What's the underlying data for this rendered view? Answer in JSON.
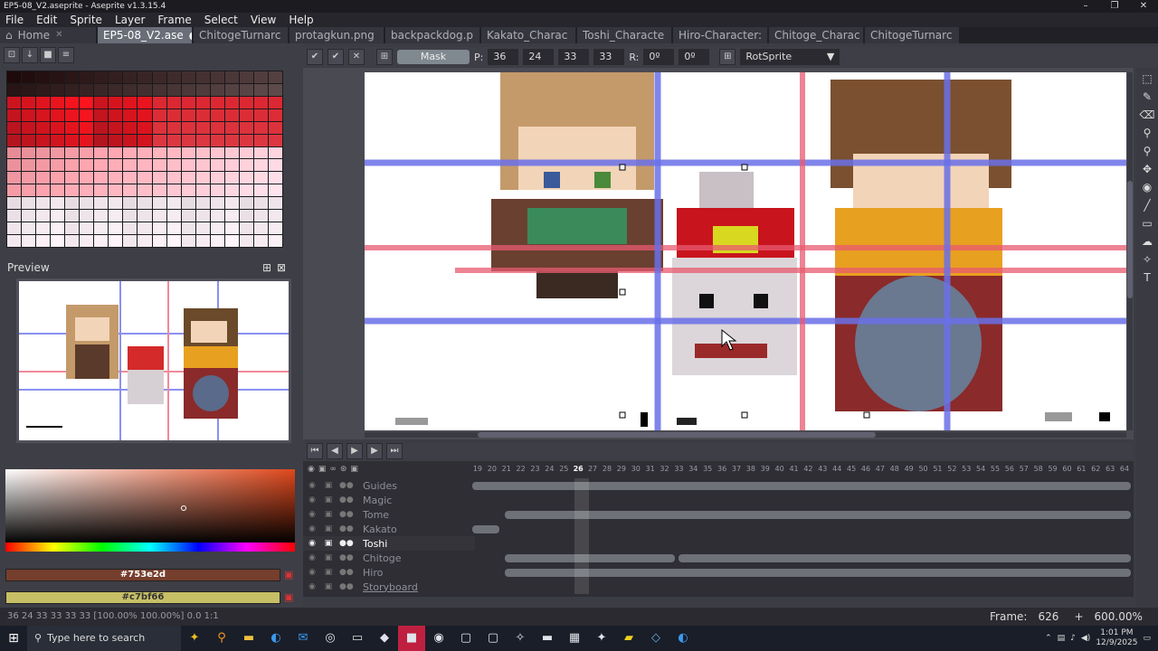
{
  "window": {
    "title": "EP5-08_V2.aseprite - Aseprite v1.3.15.4",
    "min": "–",
    "max": "❐",
    "close": "✕"
  },
  "menu": [
    "File",
    "Edit",
    "Sprite",
    "Layer",
    "Frame",
    "Select",
    "View",
    "Help"
  ],
  "tabs": [
    {
      "label": "Home",
      "active": false
    },
    {
      "label": "EP5-08_V2.ase",
      "active": true
    },
    {
      "label": "ChitogeTurnarc",
      "active": false
    },
    {
      "label": "protagkun.png",
      "active": false
    },
    {
      "label": "backpackdog.p",
      "active": false
    },
    {
      "label": "Kakato_Charac",
      "active": false
    },
    {
      "label": "Toshi_Characte",
      "active": false
    },
    {
      "label": "Hiro-Character:",
      "active": false
    },
    {
      "label": "Chitoge_Charac",
      "active": false
    },
    {
      "label": "ChitogeTurnarc",
      "active": false
    }
  ],
  "toolbar_options": {
    "mask_label": "Mask",
    "p_label": "P:",
    "p_x": "36",
    "p_y": "24",
    "p_w": "33",
    "p_h": "33",
    "r_label": "R:",
    "r1": "0º",
    "r2": "0º",
    "algorithm": "RotSprite"
  },
  "preview": {
    "title": "Preview"
  },
  "colors": {
    "foreground_hex": "#753e2d",
    "background_hex": "#c7bf66",
    "accent": "#e0481c"
  },
  "timeline": {
    "frame_numbers": [
      "19",
      "20",
      "21",
      "22",
      "23",
      "24",
      "25",
      "26",
      "27",
      "28",
      "29",
      "30",
      "31",
      "32",
      "33",
      "34",
      "35",
      "36",
      "37",
      "38",
      "39",
      "40",
      "41",
      "42",
      "43",
      "44",
      "45",
      "46",
      "47",
      "48",
      "49",
      "50",
      "51",
      "52",
      "53",
      "54",
      "55",
      "56",
      "57",
      "58",
      "59",
      "60",
      "61",
      "62",
      "63",
      "64"
    ],
    "current_frame": "26",
    "layers": [
      {
        "name": "Guides",
        "active": false
      },
      {
        "name": "Magic",
        "active": false
      },
      {
        "name": "Tome",
        "active": false
      },
      {
        "name": "Kakato",
        "active": false
      },
      {
        "name": "Toshi",
        "active": true
      },
      {
        "name": "Chitoge",
        "active": false
      },
      {
        "name": "Hiro",
        "active": false
      },
      {
        "name": "Storyboard",
        "active": false
      }
    ]
  },
  "status": {
    "text": "36 24  33 33  33 33  [100.00% 100.00%]  0.0  1:1",
    "frame_label": "Frame:",
    "frame_value": "626",
    "zoom": "600.00%"
  },
  "taskbar": {
    "search_placeholder": "Type here to search",
    "time": "1:01 PM",
    "date": "12/9/2025"
  }
}
